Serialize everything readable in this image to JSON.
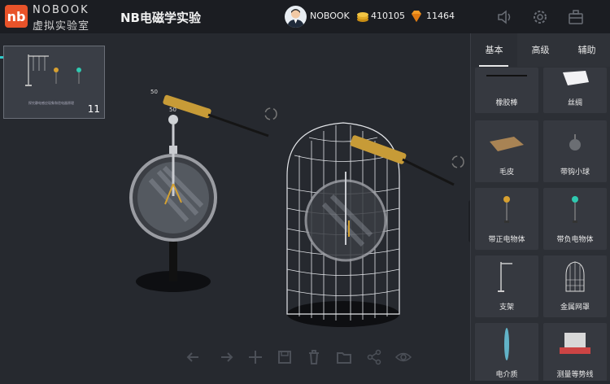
{
  "brand": {
    "name_en": "NOBOOK",
    "name_cn": "虚拟实验室",
    "logo_text": "nb",
    "accent": "#e8532a"
  },
  "app": {
    "title": "NB电磁学实验"
  },
  "user": {
    "name": "NOBOOK",
    "coins": "410105",
    "gems": "11464"
  },
  "topbar_icons": [
    "sound-icon",
    "settings-icon",
    "toolbox-icon"
  ],
  "scene": {
    "thumbnail_count": "11",
    "thumbnail_caption": "探究静电感应现象和验电器原理",
    "rod_label_left": "50",
    "rod_label_left_2": "50"
  },
  "toolbar": [
    "undo-icon",
    "redo-icon",
    "add-icon",
    "save-icon",
    "delete-icon",
    "folder-icon",
    "share-icon",
    "view-icon"
  ],
  "panel": {
    "tabs": [
      "基本",
      "高级",
      "辅助"
    ],
    "active_tab": "基本",
    "items": [
      "橡胶棒",
      "丝绸",
      "毛皮",
      "带钩小球",
      "带正电物体",
      "带负电物体",
      "支架",
      "金属网罩",
      "电介质",
      "测量等势线"
    ]
  },
  "colors": {
    "background": "#26292f",
    "topbar": "#1b1d22",
    "panel": "#2c2f35",
    "accent_cyan": "#2fc9c9"
  }
}
